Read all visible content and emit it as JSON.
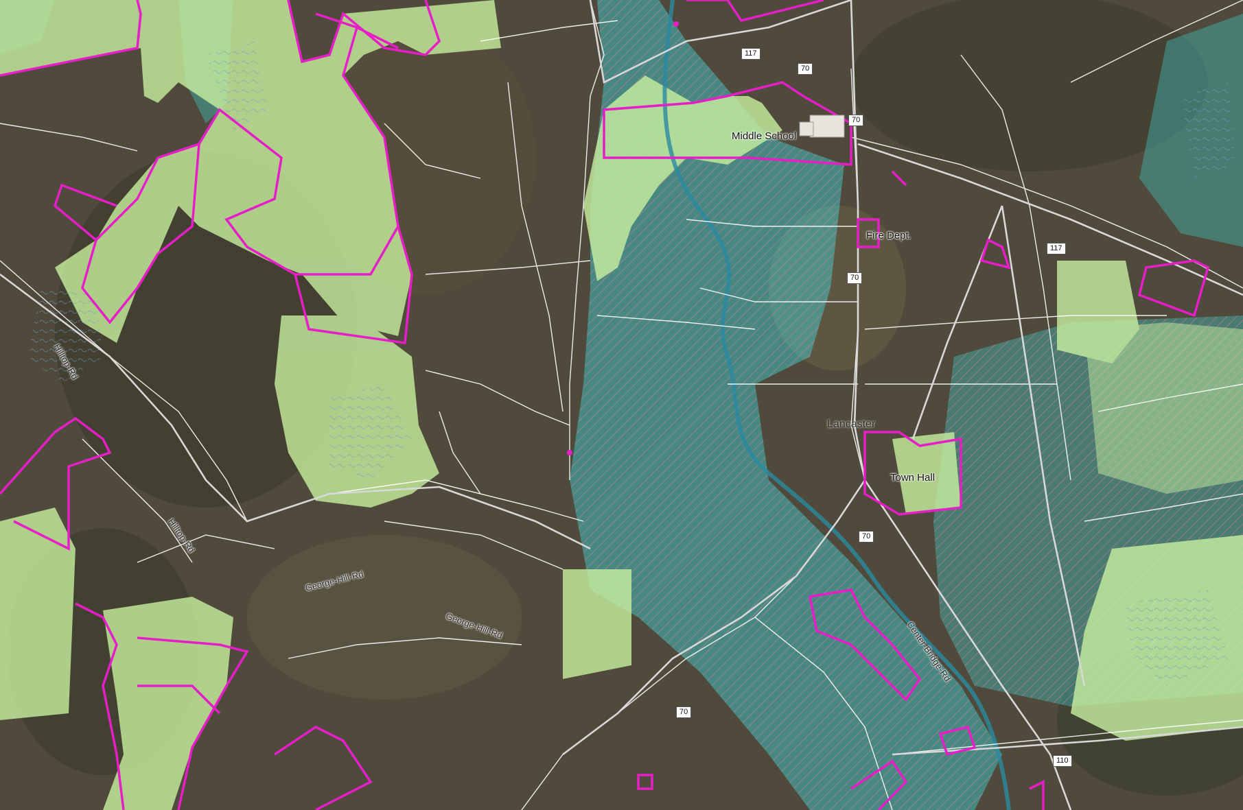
{
  "places": {
    "middle_school": "Middle School",
    "fire_dept": "Fire Dept.",
    "town_hall": "Town Hall",
    "town": "Lancaster"
  },
  "roads": {
    "hilltop_1": "Hilltop-Rd",
    "hilltop_2": "Hilltop-Rd",
    "george_hill_1": "George-Hill-Rd",
    "george_hill_2": "George-Hill-Rd",
    "center_bridge": "Center-Bridge-Rd"
  },
  "shields": {
    "r117_a": "117",
    "r70_a": "70",
    "r70_b": "70",
    "r117_b": "117",
    "r70_c": "70",
    "r70_d": "70",
    "r70_e": "70",
    "r110": "110"
  },
  "colors": {
    "protected_land_outline": "#e61ec8",
    "conserved_land_fill": "#c8f0a0",
    "floodplain_fill": "#3fd6d6",
    "parcel_line": "#ffffff",
    "aerial_base": "#4f4a3b"
  }
}
